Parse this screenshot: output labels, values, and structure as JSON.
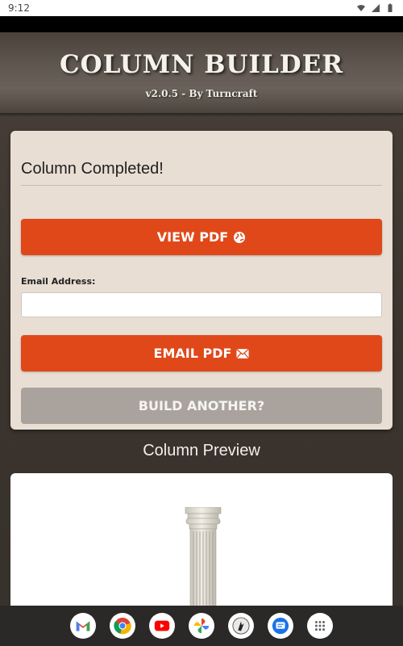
{
  "status_bar": {
    "time": "9:12"
  },
  "header": {
    "title": "COLUMN BUILDER",
    "subtitle": "v2.0.5 - By Turncraft"
  },
  "card": {
    "title": "Column Completed!",
    "view_pdf_label": "VIEW PDF",
    "email_label": "Email Address:",
    "email_value": "",
    "email_pdf_label": "EMAIL PDF",
    "build_another_label": "BUILD ANOTHER?"
  },
  "preview": {
    "title": "Column Preview"
  },
  "colors": {
    "accent": "#e0481a",
    "secondary": "#aaa39d",
    "card_bg": "#e8ded4"
  },
  "dock": [
    "gmail-icon",
    "chrome-icon",
    "youtube-icon",
    "photos-icon",
    "turncraft-app-icon",
    "messages-icon",
    "app-drawer-icon"
  ]
}
